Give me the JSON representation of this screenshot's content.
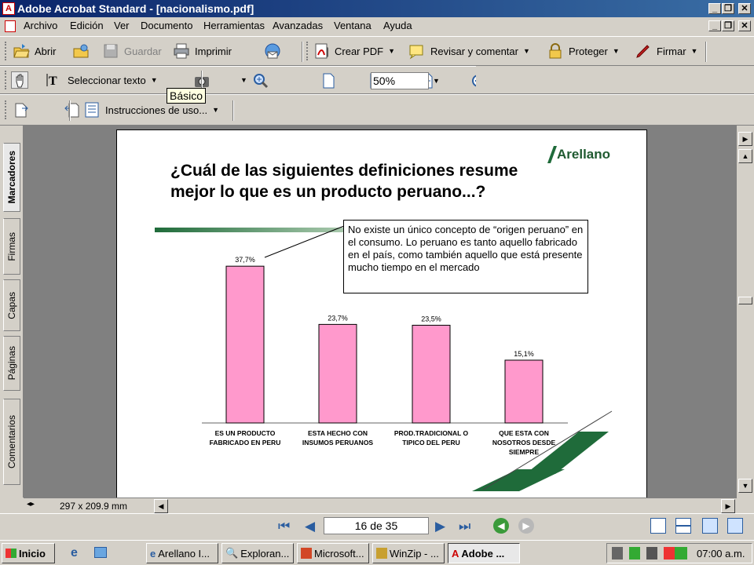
{
  "window": {
    "title": "Adobe Acrobat Standard - [nacionalismo.pdf]"
  },
  "menu": [
    "Archivo",
    "Edición",
    "Ver",
    "Documento",
    "Herramientas",
    "Avanzadas",
    "Ventana",
    "Ayuda"
  ],
  "toolbar1": {
    "open": "Abrir",
    "save": "Guardar",
    "print": "Imprimir",
    "create_pdf": "Crear PDF",
    "review": "Revisar y comentar",
    "protect": "Proteger",
    "sign": "Firmar"
  },
  "toolbar2": {
    "select_text": "Seleccionar texto",
    "zoom": "50%"
  },
  "toolbar3": {
    "instructions": "Instrucciones de uso..."
  },
  "tooltip": "Básico",
  "side_tabs": [
    "Marcadores",
    "Firmas",
    "Capas",
    "Páginas",
    "Comentarios"
  ],
  "slide": {
    "title_line1": "¿Cuál de las siguientes definiciones resume",
    "title_line2": "mejor lo que es un producto peruano...?",
    "logo": "Arellano",
    "callout": "No existe un único concepto de “origen peruano” en el consumo. Lo peruano es tanto aquello fabricado en el país, como también aquello que está presente mucho tiempo en el mercado"
  },
  "chart_data": {
    "type": "bar",
    "categories": [
      [
        "ES UN PRODUCTO",
        "FABRICADO EN PERU"
      ],
      [
        "ESTA HECHO CON",
        "INSUMOS PERUANOS"
      ],
      [
        "PROD.TRADICIONAL O",
        "TIPICO DEL PERU"
      ],
      [
        "QUE ESTA CON",
        "NOSOTROS DESDE",
        "SIEMPRE"
      ]
    ],
    "values": [
      37.7,
      23.7,
      23.5,
      15.1
    ],
    "value_labels": [
      "37,7%",
      "23,7%",
      "23,5%",
      "15,1%"
    ],
    "bar_color": "#ff99cc",
    "ylim": [
      0,
      40
    ]
  },
  "status": {
    "page_size": "297 x 209.9 mm"
  },
  "nav": {
    "page": "16 de 35"
  },
  "taskbar": {
    "start": "Inicio",
    "tasks": [
      "Arellano I...",
      "Exploran...",
      "Microsoft...",
      "WinZip - ...",
      "Adobe ..."
    ],
    "clock": "07:00 a.m."
  }
}
